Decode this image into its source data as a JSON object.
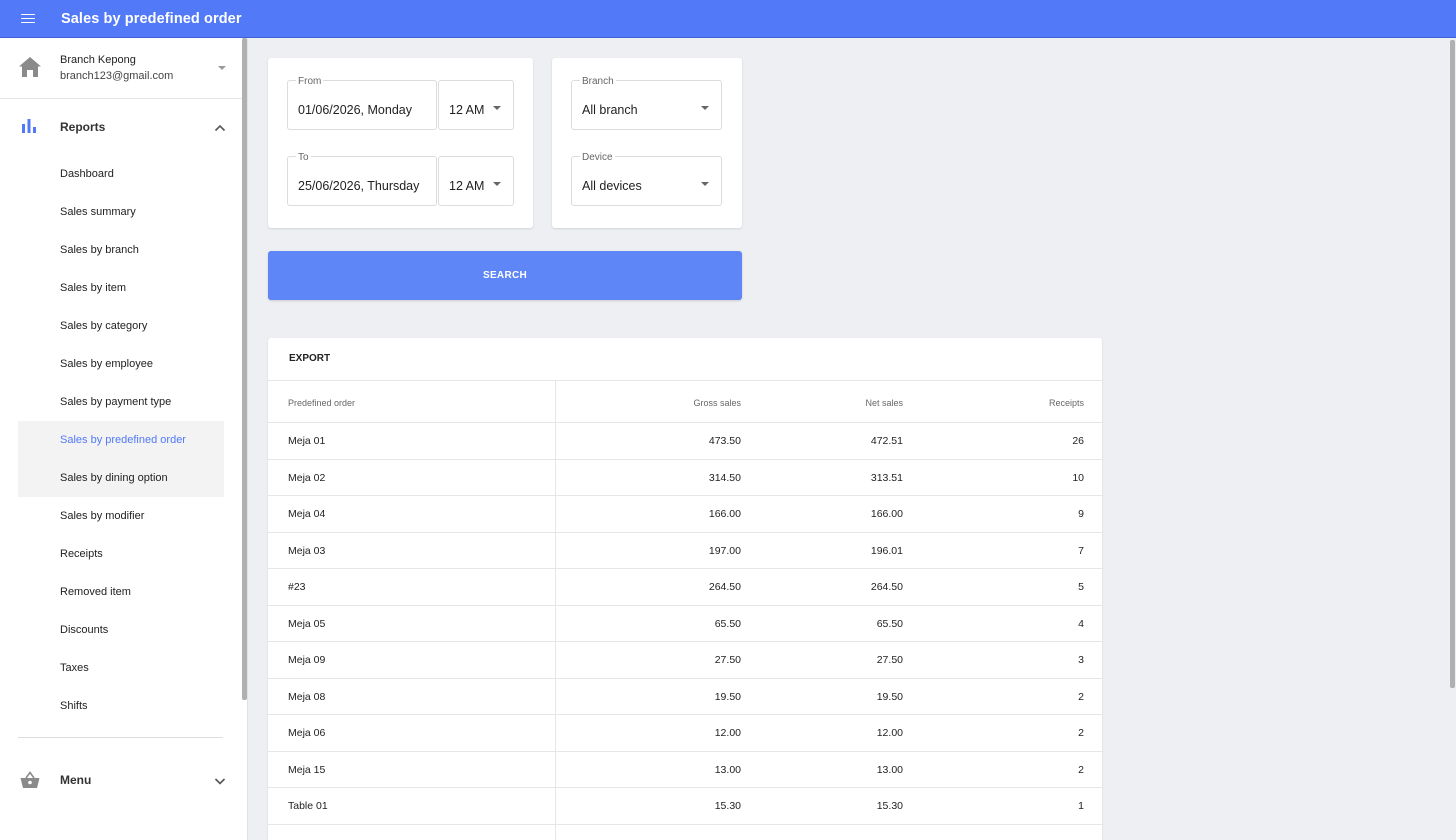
{
  "header": {
    "title": "Sales by predefined order"
  },
  "account": {
    "name": "Branch Kepong",
    "email": "branch123@gmail.com"
  },
  "sidebar": {
    "reports_label": "Reports",
    "items": [
      {
        "label": "Dashboard"
      },
      {
        "label": "Sales summary"
      },
      {
        "label": "Sales by branch"
      },
      {
        "label": "Sales by item"
      },
      {
        "label": "Sales by category"
      },
      {
        "label": "Sales by employee"
      },
      {
        "label": "Sales by payment type"
      },
      {
        "label": "Sales by predefined order"
      },
      {
        "label": "Sales by dining option"
      },
      {
        "label": "Sales by modifier"
      },
      {
        "label": "Receipts"
      },
      {
        "label": "Removed item"
      },
      {
        "label": "Discounts"
      },
      {
        "label": "Taxes"
      },
      {
        "label": "Shifts"
      }
    ],
    "menu_label": "Menu"
  },
  "filters": {
    "from_label": "From",
    "from_date": "01/06/2026, Monday",
    "from_time": "12 AM",
    "to_label": "To",
    "to_date": "25/06/2026, Thursday",
    "to_time": "12 AM",
    "branch_label": "Branch",
    "branch_value": "All branch",
    "device_label": "Device",
    "device_value": "All devices",
    "search_label": "SEARCH"
  },
  "table": {
    "export_label": "EXPORT",
    "headers": {
      "order": "Predefined order",
      "gross": "Gross sales",
      "net": "Net sales",
      "receipts": "Receipts"
    },
    "rows": [
      {
        "order": "Meja 01",
        "gross": "473.50",
        "net": "472.51",
        "receipts": "26"
      },
      {
        "order": "Meja 02",
        "gross": "314.50",
        "net": "313.51",
        "receipts": "10"
      },
      {
        "order": "Meja 04",
        "gross": "166.00",
        "net": "166.00",
        "receipts": "9"
      },
      {
        "order": "Meja 03",
        "gross": "197.00",
        "net": "196.01",
        "receipts": "7"
      },
      {
        "order": "#23",
        "gross": "264.50",
        "net": "264.50",
        "receipts": "5"
      },
      {
        "order": "Meja 05",
        "gross": "65.50",
        "net": "65.50",
        "receipts": "4"
      },
      {
        "order": "Meja 09",
        "gross": "27.50",
        "net": "27.50",
        "receipts": "3"
      },
      {
        "order": "Meja 08",
        "gross": "19.50",
        "net": "19.50",
        "receipts": "2"
      },
      {
        "order": "Meja 06",
        "gross": "12.00",
        "net": "12.00",
        "receipts": "2"
      },
      {
        "order": "Meja 15",
        "gross": "13.00",
        "net": "13.00",
        "receipts": "2"
      },
      {
        "order": "Table 01",
        "gross": "15.30",
        "net": "15.30",
        "receipts": "1"
      }
    ]
  },
  "colors": {
    "primary": "#5279f8",
    "button": "#5f86f7",
    "background": "#eeeff3"
  },
  "icons": {
    "menu": "hamburger-icon",
    "home": "home-icon",
    "reports": "bar-chart-icon",
    "menu_section": "basket-icon"
  }
}
